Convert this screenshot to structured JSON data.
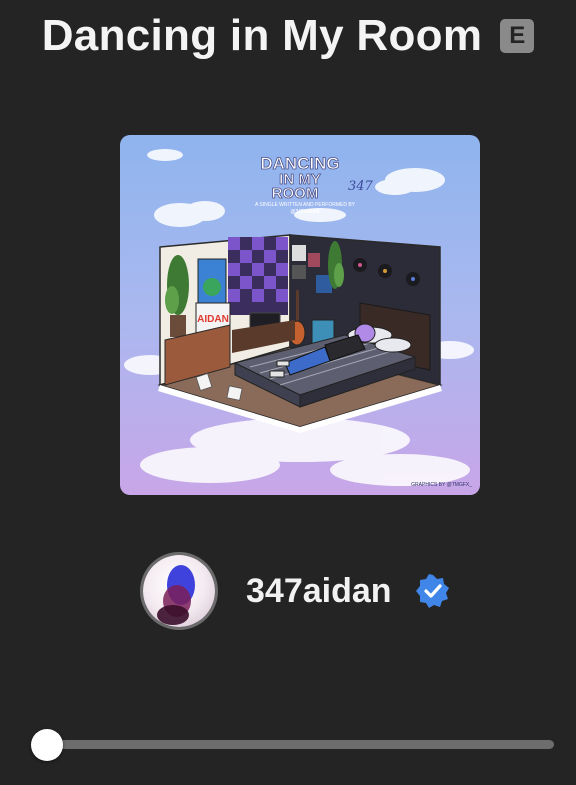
{
  "track": {
    "title": "Dancing in My Room",
    "explicit_badge": "E"
  },
  "album_art": {
    "title_line1": "DANCING",
    "title_line2": "IN MY",
    "title_line3": "ROOM",
    "script_text": "347",
    "subtitle": "A SINGLE WRITTEN AND PERFORMED BY",
    "handle": "@347AIDAN",
    "poster_text": "AIDAN",
    "credit": "GRAPHICS BY @TMGFX_"
  },
  "artist": {
    "name": "347aidan",
    "verified_icon": "verified-check-icon",
    "verified_color": "#3f86e8"
  },
  "playback": {
    "progress": 0.0
  },
  "colors": {
    "background": "#242424",
    "scrubber_track": "#6d6d6d",
    "scrubber_thumb": "#ffffff"
  }
}
